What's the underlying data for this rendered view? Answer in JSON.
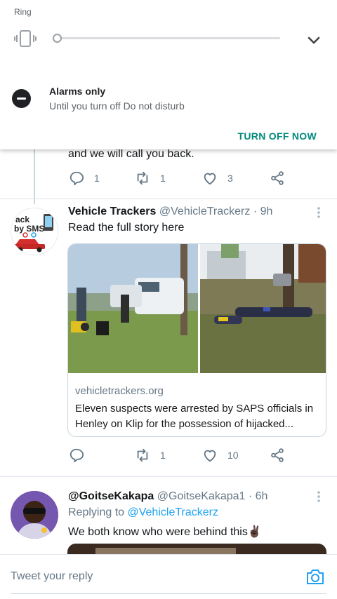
{
  "notification_shade": {
    "ring_label": "Ring",
    "ring_icon": "vibrate-icon",
    "volume_fraction": 0.0,
    "expand_icon": "chevron-down-icon",
    "dnd_icon": "do-not-disturb-icon",
    "dnd_title": "Alarms only",
    "dnd_subtitle": "Until you turn off Do not disturb",
    "turn_off_label": "TURN OFF NOW",
    "accent_color": "#00897b"
  },
  "tweet_prev": {
    "text_tail": "and we will call you back.",
    "reply_count": "1",
    "retweet_count": "1",
    "like_count": "3"
  },
  "tweet_main": {
    "display_name": "Vehicle Trackers",
    "handle": "@VehicleTrackerz",
    "time": "· 9h",
    "text": "Read the full story here",
    "card": {
      "domain": "vehicletrackers.org",
      "title": "Eleven suspects were arrested by SAPS officials in Henley on Klip for the possession of hijacked..."
    },
    "reply_count": "",
    "retweet_count": "1",
    "like_count": "10"
  },
  "tweet_reply": {
    "display_name": "@GoitseKakapa",
    "handle": "@GoitseKakapa1",
    "time": "· 6h",
    "replying_prefix": "Replying to",
    "replying_to": "@VehicleTrackerz",
    "text": "We both know who were behind this",
    "emoji": "✌🏿"
  },
  "reply_bar": {
    "placeholder": "Tweet your reply",
    "camera_icon": "camera-icon"
  },
  "colors": {
    "link": "#1da1f2",
    "muted": "#657786",
    "divider": "#e1e8ed"
  }
}
